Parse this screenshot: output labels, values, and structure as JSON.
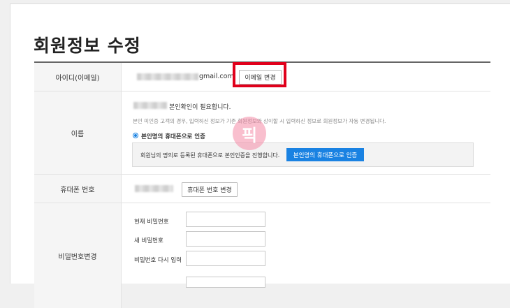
{
  "page_title": "회원정보 수정",
  "email_row": {
    "label": "아이디(이메일)",
    "email_domain": "gmail.com",
    "button": "이메일 변경"
  },
  "name_row": {
    "label": "이름",
    "notice": "본인확인이 필요합니다.",
    "sub_notice": "본인 미인증 고객의 경우, 입력하신 정보가 기존 회원정보와 상이할 시 입력하신 정보로 회원정보가 자동 변경됩니다.",
    "radio_label": "본인명의 휴대폰으로 인증",
    "auth_text": "회원님의 명의로 등록된 휴대폰으로 본인인증을 진행합니다.",
    "auth_button": "본인명의 휴대폰으로 인증"
  },
  "phone_row": {
    "label": "휴대폰 번호",
    "button": "휴대폰 번호 변경"
  },
  "password_row": {
    "label": "비밀번호변경",
    "current_label": "현재 비밀번호",
    "new_label": "새 비밀번호",
    "confirm_label": "비밀번호 다시 입력"
  },
  "watermark": "픽",
  "colors": {
    "highlight": "#e0001b",
    "primary": "#1a82e2",
    "watermark": "#f48aa6"
  }
}
